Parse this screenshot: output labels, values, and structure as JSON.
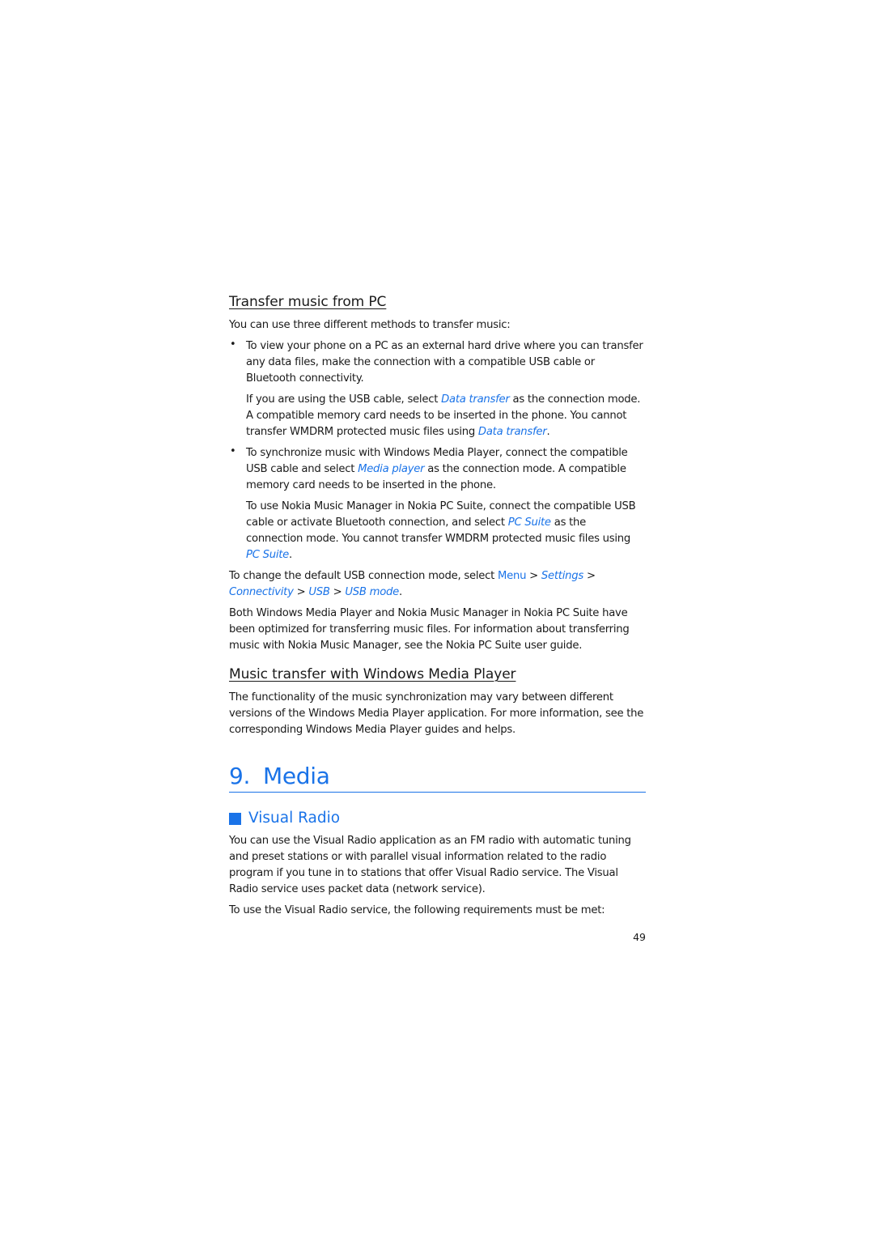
{
  "sections": {
    "transfer": {
      "heading": "Transfer music from PC",
      "intro": "You can use three different methods to transfer music:",
      "bullet1": {
        "text": "To view your phone on a PC as an external hard drive where you can transfer any data files, make the connection with a compatible USB cable or Bluetooth connectivity.",
        "sub_a": "If you are using the USB cable, select ",
        "sub_link1": "Data transfer",
        "sub_b": " as the connection mode. A compatible memory card needs to be inserted in the phone. You cannot transfer WMDRM protected music files using ",
        "sub_link2": "Data transfer",
        "sub_c": "."
      },
      "bullet2": {
        "text_a": "To synchronize music with Windows Media Player, connect the compatible USB cable and select ",
        "link": "Media player",
        "text_b": " as the connection mode. A compatible memory card needs to be inserted in the phone.",
        "sub_a": "To use Nokia Music Manager in Nokia PC Suite, connect the compatible USB cable or activate Bluetooth connection, and select ",
        "sub_link1": "PC Suite",
        "sub_b": " as the connection mode. You cannot transfer WMDRM protected music files using ",
        "sub_link2": "PC Suite",
        "sub_c": "."
      },
      "change_mode": {
        "text_a": "To change the default USB connection mode, select ",
        "menu": "Menu",
        "sep": " > ",
        "path1": "Settings",
        "path2": "Connectivity",
        "path3": "USB",
        "path4": "USB mode",
        "end": "."
      },
      "both": "Both Windows Media Player and Nokia Music Manager in Nokia PC Suite have been optimized for transferring music files. For information about transferring music with Nokia Music Manager, see the Nokia PC Suite user guide."
    },
    "wmp": {
      "heading": "Music transfer with Windows Media Player",
      "text": "The functionality of the music synchronization may vary between different versions of the Windows Media Player application. For more information, see the corresponding Windows Media Player guides and helps."
    },
    "chapter": {
      "number": "9.",
      "title": "Media"
    },
    "visual_radio": {
      "heading": "Visual Radio",
      "p1": "You can use the Visual Radio application as an FM radio with automatic tuning and preset stations or with parallel visual information related to the radio program if you tune in to stations that offer Visual Radio service. The Visual Radio service uses packet data (network service).",
      "p2": "To use the Visual Radio service, the following requirements must be met:"
    }
  },
  "page_number": "49",
  "colors": {
    "accent": "#1a73e8",
    "text": "#1a1a1a"
  }
}
